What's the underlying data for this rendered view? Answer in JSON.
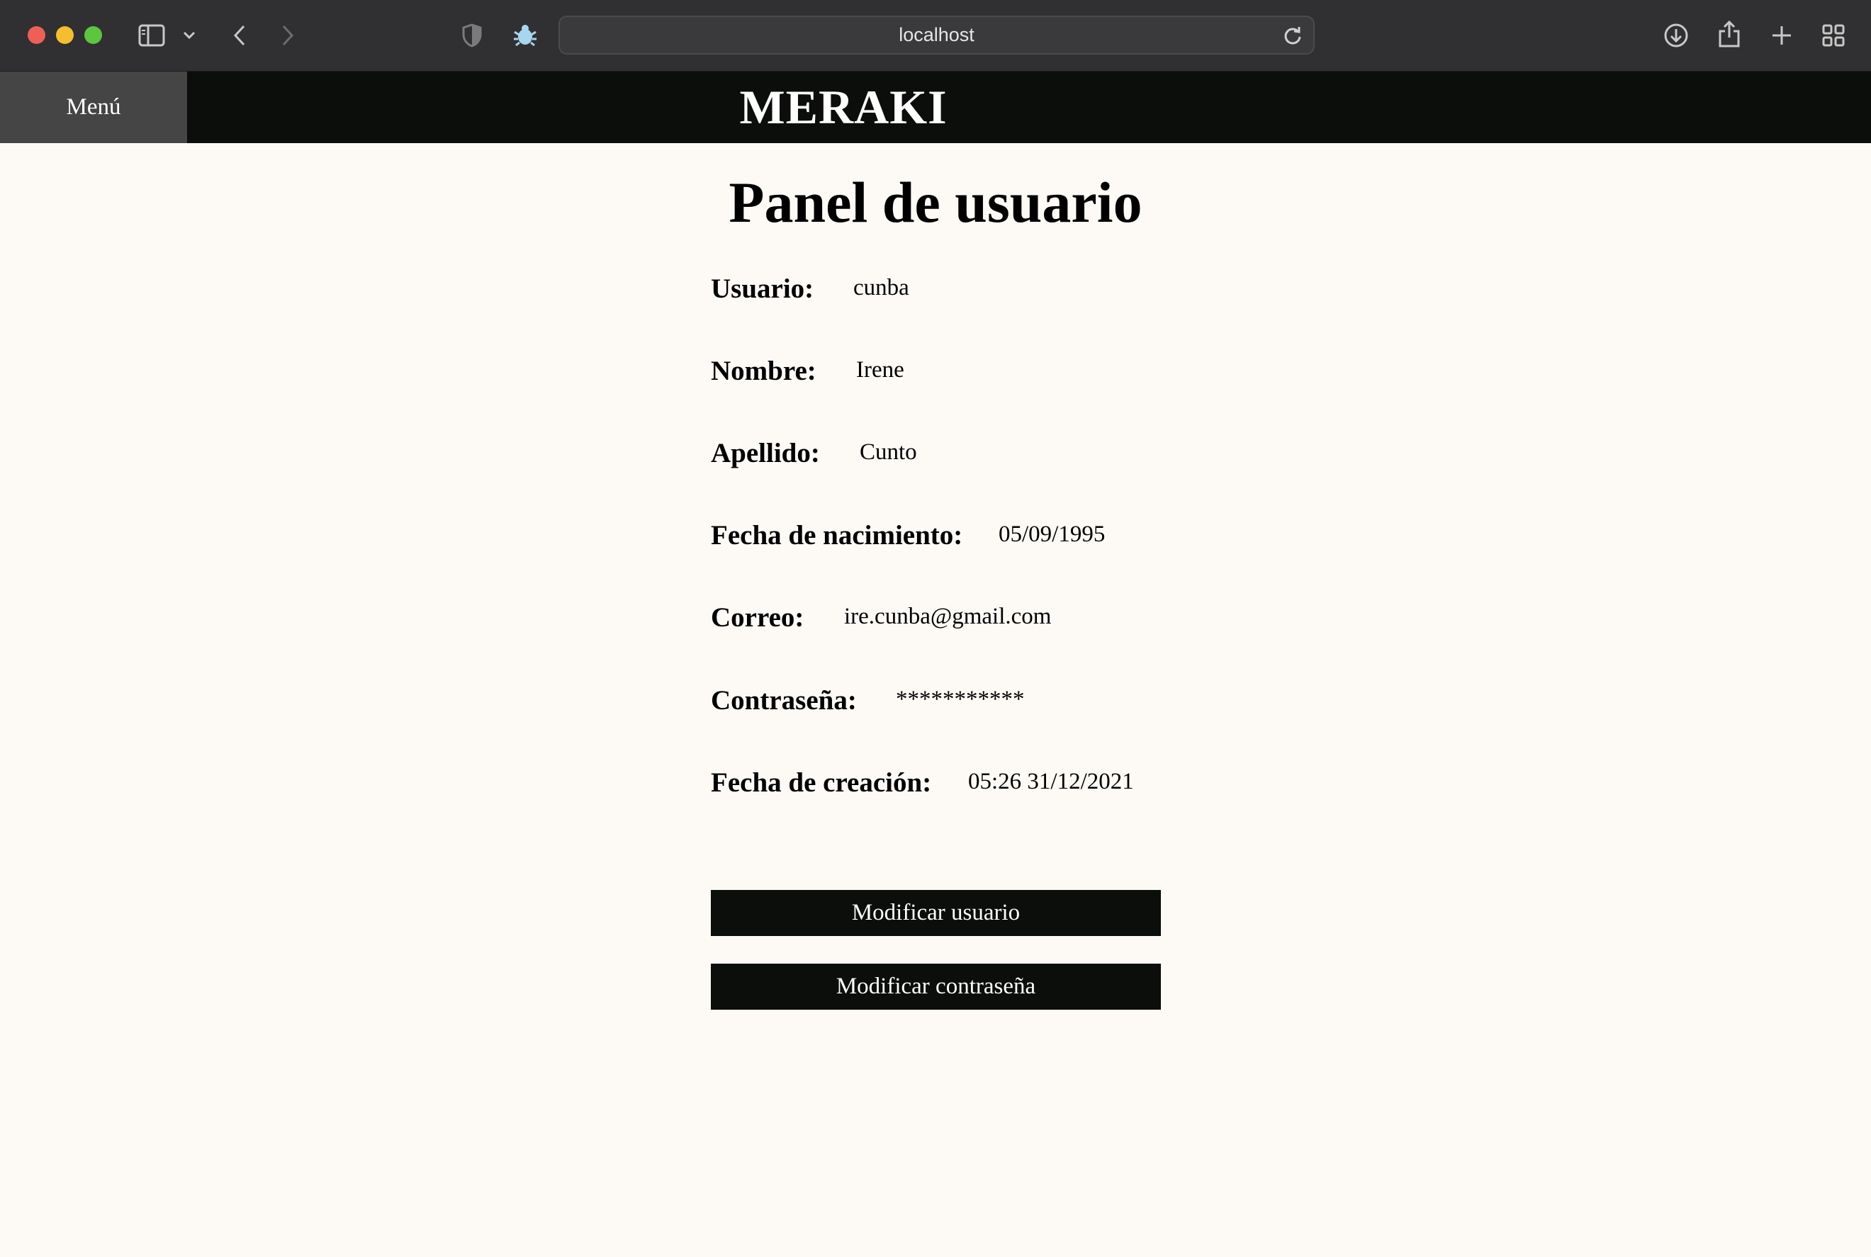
{
  "browser": {
    "url": "localhost"
  },
  "header": {
    "menu_label": "Menú",
    "brand": "MERAKI"
  },
  "page": {
    "title": "Panel de usuario"
  },
  "fields": [
    {
      "label": "Usuario:",
      "value": "cunba"
    },
    {
      "label": "Nombre:",
      "value": "Irene"
    },
    {
      "label": "Apellido:",
      "value": "Cunto"
    },
    {
      "label": "Fecha de nacimiento:",
      "value": "05/09/1995"
    },
    {
      "label": "Correo:",
      "value": "ire.cunba@gmail.com"
    },
    {
      "label": "Contraseña:",
      "value": "***********"
    },
    {
      "label": "Fecha de creación:",
      "value": "05:26 31/12/2021"
    }
  ],
  "actions": {
    "modify_user": "Modificar usuario",
    "modify_password": "Modificar contraseña"
  }
}
